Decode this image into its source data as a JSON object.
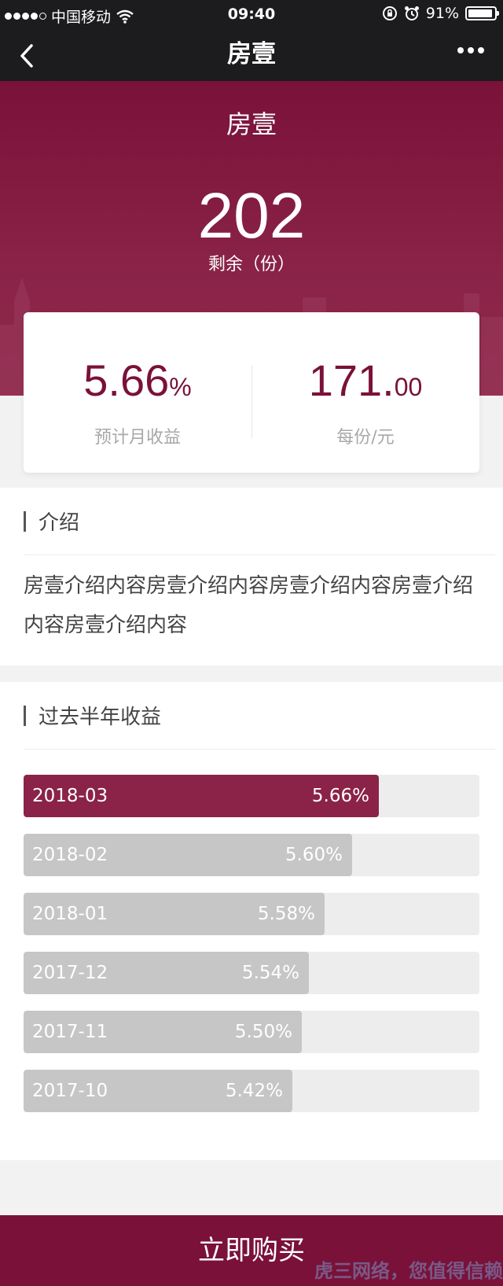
{
  "status_bar": {
    "carrier": "中国移动",
    "time": "09:40",
    "battery": "91%",
    "icons": [
      "signal-dots-icon",
      "wifi-icon",
      "lock-rotation-icon",
      "alarm-icon",
      "battery-icon"
    ]
  },
  "nav": {
    "title": "房壹",
    "back_icon": "chevron-left-icon",
    "more_icon": "more-dots-icon"
  },
  "hero": {
    "product_name": "房壹",
    "remaining": "202",
    "remaining_label": "剩余（份）"
  },
  "stats": {
    "monthly_yield_int": "5.66",
    "monthly_yield_unit": "%",
    "monthly_yield_label": "预计月收益",
    "price_int": "171.",
    "price_dec": "00",
    "price_label": "每份/元"
  },
  "intro": {
    "heading": "介绍",
    "text": "房壹介绍内容房壹介绍内容房壹介绍内容房壹介绍内容房壹介绍内容"
  },
  "income": {
    "heading": "过去半年收益",
    "rows": [
      {
        "date": "2018-03",
        "rate": "5.66%",
        "fill": 0.78,
        "active": true
      },
      {
        "date": "2018-02",
        "rate": "5.60%",
        "fill": 0.72,
        "active": false
      },
      {
        "date": "2018-01",
        "rate": "5.58%",
        "fill": 0.66,
        "active": false
      },
      {
        "date": "2017-12",
        "rate": "5.54%",
        "fill": 0.625,
        "active": false
      },
      {
        "date": "2017-11",
        "rate": "5.50%",
        "fill": 0.61,
        "active": false
      },
      {
        "date": "2017-10",
        "rate": "5.42%",
        "fill": 0.59,
        "active": false
      }
    ]
  },
  "footer": {
    "buy_label": "立即购买",
    "watermark": "虎三网络，您值得信赖"
  },
  "colors": {
    "brand": "#7a1139",
    "bar_active": "#8a2347",
    "bar_inactive": "#c6c6c6",
    "bar_track": "#ededed"
  }
}
